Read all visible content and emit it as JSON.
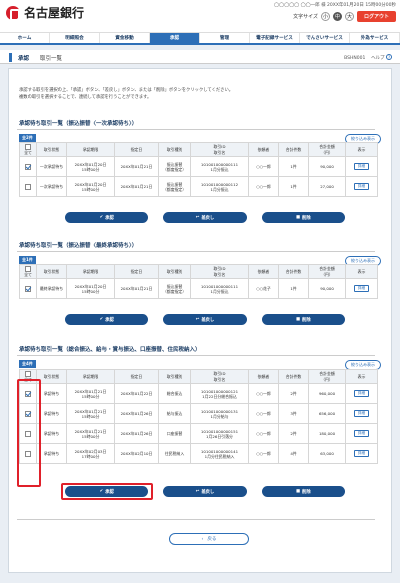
{
  "header": {
    "bank_name": "名古屋銀行",
    "user_line": "◯◯◯◯◯ ◯◯一郎 様 20XX年01月20日 15時00分00秒",
    "font_size_label": "文字サイズ",
    "font_sizes": [
      "小",
      "中",
      "大"
    ],
    "logout": "ログアウト"
  },
  "nav": [
    "ホーム",
    "明細照会",
    "資金移動",
    "承認",
    "管理",
    "電子記録サービス",
    "でんさいサービス",
    "外為サービス"
  ],
  "sub": {
    "title": "承認",
    "page": "取引一覧",
    "screen_id": "BSHN001",
    "help": "ヘルプ"
  },
  "intro": [
    "承認する取引を選択の上、「承認」ボタン、「差戻し」ボタン、または「削除」ボタンをクリックしてください。",
    "複数の取引を選択することで、連続して承認を行うことができます。"
  ],
  "headers": [
    "全て",
    "取引状態",
    "承認期限",
    "指定日",
    "取引種別",
    "取引ID\n取引名",
    "依頼者",
    "合計件数",
    "合計金額\n（円）",
    "表示"
  ],
  "common": {
    "filter": "絞り込み表示",
    "approve": "承認",
    "reject": "差戻し",
    "delete": "削除",
    "detail": "詳細"
  },
  "sections": [
    {
      "title": "承認待ち取引一覧（振込振替〈一次承認待ち〉）",
      "count": "全2件",
      "rows": [
        {
          "checked": true,
          "status": "一次承認待ち",
          "deadline": "20XX年01月20日\n15時00分",
          "date": "20XX年01月21日",
          "type": "振込振替\n（都度指定）",
          "id": "101001000000111\n1月分振込",
          "requester": "○○一郎",
          "count": "1件",
          "amount": "90,000"
        },
        {
          "checked": false,
          "status": "一次承認待ち",
          "deadline": "20XX年01月20日\n15時00分",
          "date": "20XX年01月21日",
          "type": "振込振替\n（都度指定）",
          "id": "101001000000112\n1月分振込",
          "requester": "○○一郎",
          "count": "1件",
          "amount": "27,000"
        }
      ]
    },
    {
      "title": "承認待ち取引一覧（振込振替〈最終承認待ち〉）",
      "count": "全1件",
      "rows": [
        {
          "checked": true,
          "status": "最終承認待ち",
          "deadline": "20XX年01月20日\n15時00分",
          "date": "20XX年01月21日",
          "type": "振込振替\n（都度指定）",
          "id": "101001000000111\n1月分振込",
          "requester": "○○花子",
          "count": "1件",
          "amount": "90,000"
        }
      ]
    },
    {
      "title": "承認待ち取引一覧（総合振込、給与・賞与振込、口座振替、住民税納入）",
      "count": "全4件",
      "rows": [
        {
          "checked": true,
          "status": "承認待ち",
          "deadline": "20XX年01月21日\n15時00分",
          "date": "20XX年01月22日",
          "type": "総合振込",
          "id": "101001000000121\n1月22日分総合振込",
          "requester": "○○一郎",
          "count": "2件",
          "amount": "960,000"
        },
        {
          "checked": true,
          "status": "承認待ち",
          "deadline": "20XX年01月21日\n15時00分",
          "date": "20XX年01月26日",
          "type": "給与振込",
          "id": "101001000000131\n1月分給与",
          "requester": "○○一郎",
          "count": "3件",
          "amount": "656,000"
        },
        {
          "checked": false,
          "status": "承認待ち",
          "deadline": "20XX年01月21日\n15時00分",
          "date": "20XX年01月26日",
          "type": "口座振替",
          "id": "101001000000151\n1月26日引落分",
          "requester": "○○一郎",
          "count": "2件",
          "amount": "180,000"
        },
        {
          "checked": false,
          "status": "承認待ち",
          "deadline": "20XX年02月03日\n17時00分",
          "date": "20XX年02月10日",
          "type": "住民税納入",
          "id": "101001000000141\n1月分住民税納入",
          "requester": "○○一郎",
          "count": "4件",
          "amount": "63,000"
        }
      ]
    }
  ],
  "back": "戻る"
}
